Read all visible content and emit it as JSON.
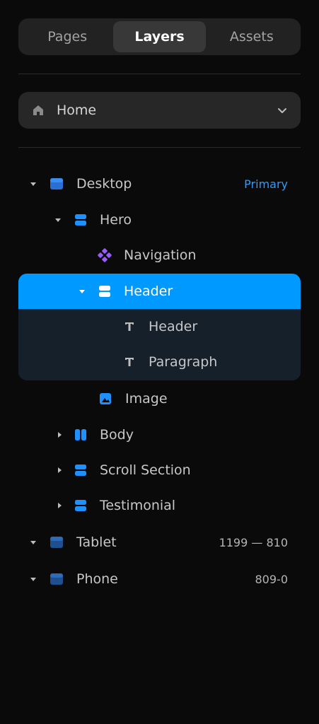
{
  "tabs": [
    {
      "label": "Pages",
      "active": false
    },
    {
      "label": "Layers",
      "active": true
    },
    {
      "label": "Assets",
      "active": false
    }
  ],
  "page_select": {
    "label": "Home",
    "icon": "home-icon"
  },
  "layers": [
    {
      "label": "Desktop",
      "meta": "Primary",
      "icon": "frame-icon",
      "expanded": true
    },
    {
      "label": "Hero",
      "icon": "stack-icon",
      "expanded": true
    },
    {
      "label": "Navigation",
      "icon": "component-icon"
    },
    {
      "label": "Header",
      "icon": "stack-icon",
      "expanded": true,
      "selected": true
    },
    {
      "label": "Header",
      "icon": "text-icon"
    },
    {
      "label": "Paragraph",
      "icon": "text-icon"
    },
    {
      "label": "Image",
      "icon": "image-icon"
    },
    {
      "label": "Body",
      "icon": "columns-icon",
      "expanded": false
    },
    {
      "label": "Scroll Section",
      "icon": "stack-icon",
      "expanded": false
    },
    {
      "label": "Testimonial",
      "icon": "stack-icon",
      "expanded": false
    },
    {
      "label": "Tablet",
      "meta": "1199 — 810",
      "icon": "frame-icon",
      "expanded": true
    },
    {
      "label": "Phone",
      "meta": "809-0",
      "icon": "frame-icon",
      "expanded": true
    }
  ],
  "colors": {
    "accent": "#0099ff",
    "primary_text": "#2e9bff",
    "component": "#9b5cff",
    "selected_bg": "#16202b"
  }
}
